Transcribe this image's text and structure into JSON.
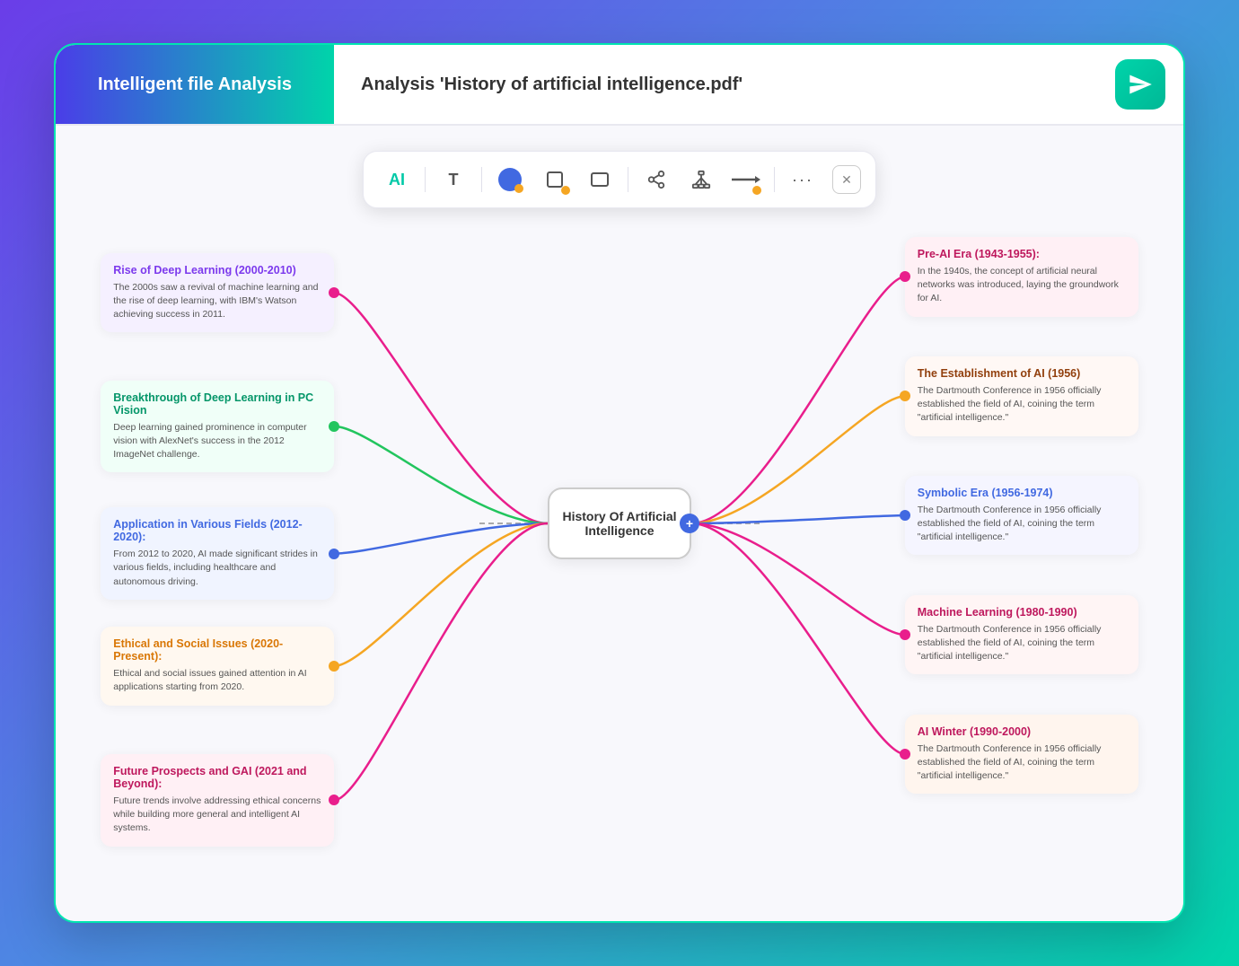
{
  "header": {
    "brand": "Intelligent file Analysis",
    "title_prefix": "Analysis ",
    "title_file": "'History of artificial intelligence.pdf'"
  },
  "toolbar": {
    "ai_label": "AI",
    "t_label": "T",
    "close_label": "✕",
    "more_label": "···"
  },
  "center": {
    "title": "History Of Artificial Intelligence"
  },
  "left_nodes": [
    {
      "title": "Rise of Deep Learning (2000-2010)",
      "desc": "The 2000s saw a revival of machine learning and the rise of deep learning, with IBM's Watson achieving success in 2011.",
      "color": "#d946a8",
      "dot_color": "#e91e8c"
    },
    {
      "title": "Breakthrough of Deep Learning in PC Vision",
      "desc": "Deep learning gained prominence in computer vision with AlexNet's success in the 2012 ImageNet challenge.",
      "color": "#22c55e",
      "dot_color": "#22c55e"
    },
    {
      "title": "Application in Various Fields (2012-2020):",
      "desc": "From 2012 to 2020, AI made significant strides in various fields, including healthcare and autonomous driving.",
      "color": "#4169e1",
      "dot_color": "#4169e1"
    },
    {
      "title": "Ethical and Social Issues  (2020-Present):",
      "desc": "Ethical and social issues gained attention in AI applications starting from 2020.",
      "color": "#f5a623",
      "dot_color": "#f5a623"
    },
    {
      "title": "Future Prospects and GAI (2021 and Beyond):",
      "desc": "Future trends involve addressing ethical concerns while building more general and intelligent AI systems.",
      "color": "#e91e8c",
      "dot_color": "#e91e8c"
    }
  ],
  "right_nodes": [
    {
      "title": "Pre-AI Era (1943-1955):",
      "desc": "In the 1940s, the concept of artificial neural networks was introduced, laying the groundwork for AI.",
      "color": "#e91e8c",
      "dot_color": "#e91e8c"
    },
    {
      "title": "The Establishment of AI (1956)",
      "desc": "The Dartmouth Conference in 1956 officially established the field of AI, coining the term \"artificial intelligence.\"",
      "color": "#f5a623",
      "dot_color": "#f5a623"
    },
    {
      "title": "Symbolic Era (1956-1974)",
      "desc": "The Dartmouth Conference in 1956 officially established the field of AI, coining the term \"artificial intelligence.\"",
      "color": "#4169e1",
      "dot_color": "#4169e1"
    },
    {
      "title": "Machine Learning (1980-1990)",
      "desc": "The Dartmouth Conference in 1956 officially established the field of AI, coining the term \"artificial intelligence.\"",
      "color": "#e91e8c",
      "dot_color": "#e91e8c"
    },
    {
      "title": "AI Winter (1990-2000)",
      "desc": "The Dartmouth Conference in 1956 officially established the field of AI, coining the term \"artificial intelligence.\"",
      "color": "#e91e8c",
      "dot_color": "#e91e8c"
    }
  ]
}
